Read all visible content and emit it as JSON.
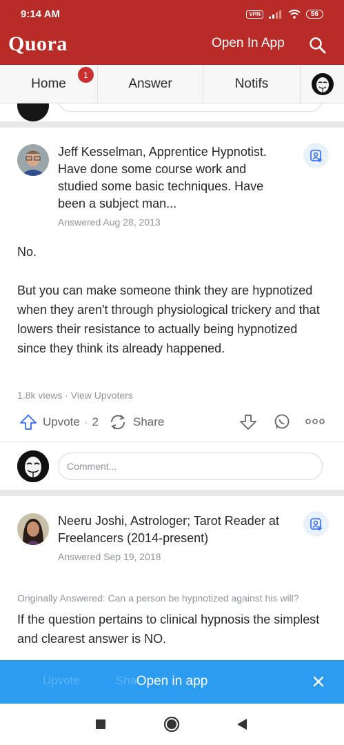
{
  "status_bar": {
    "time": "9:14 AM",
    "vpn": "VPN",
    "battery": "56"
  },
  "header": {
    "brand": "Quora",
    "open_in_app": "Open In App",
    "search_icon": "search-icon"
  },
  "nav": {
    "tabs": [
      {
        "label": "Home",
        "badge": "1"
      },
      {
        "label": "Answer"
      },
      {
        "label": "Notifs"
      }
    ]
  },
  "answer1": {
    "author": "Jeff Kesselman, Apprentice Hypnotist. Have done some course work and studied some basic techniques. Have been a subject man...",
    "date": "Answered Aug 28, 2013",
    "paragraphs": [
      "No.",
      "But you can make someone think they are hypnotized when they aren't through physiological trickery and that lowers their resistance to actually being hypnotized since they think its already happened."
    ],
    "stats": "1.8k views · View Upvoters",
    "upvote_label": "Upvote",
    "upvote_count": "2",
    "share_label": "Share"
  },
  "comment": {
    "placeholder": "Comment..."
  },
  "answer2": {
    "author": "Neeru Joshi, Astrologer; Tarot Reader at Freelancers (2014-present)",
    "date": "Answered Sep 19, 2018",
    "originally": "Originally Answered: Can a person be hypnotized against his will?",
    "text": "If the question pertains to clinical hypnosis the simplest and clearest answer is NO."
  },
  "floating_bar": {
    "label": "Open in app",
    "ghost_upvote": "Upvote",
    "ghost_share": "Sha"
  },
  "colors": {
    "brand_red": "#b92b27",
    "accent_blue": "#2b9cf0",
    "badge_red": "#cb3030"
  }
}
